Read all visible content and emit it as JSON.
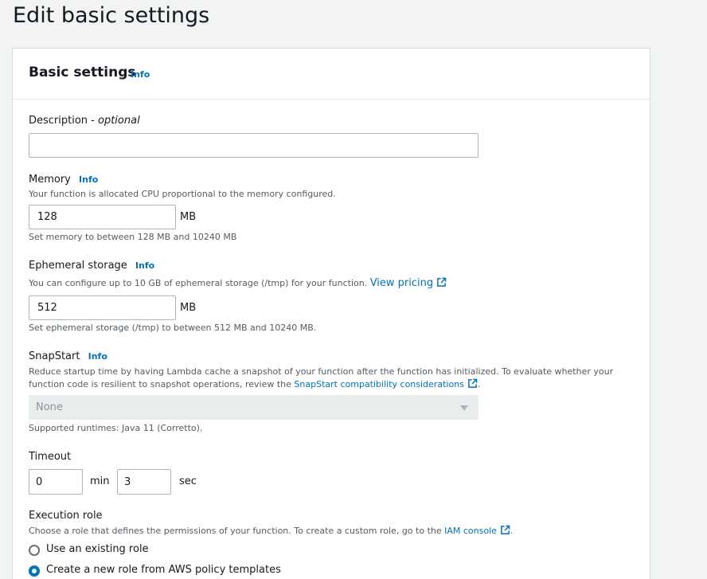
{
  "page_title": "Edit basic settings",
  "panel": {
    "title": "Basic settings",
    "info": "Info"
  },
  "description": {
    "label": "Description - ",
    "label_optional": "optional",
    "value": ""
  },
  "memory": {
    "label": "Memory",
    "info": "Info",
    "desc": "Your function is allocated CPU proportional to the memory configured.",
    "value": "128",
    "unit": "MB",
    "hint": "Set memory to between 128 MB and 10240 MB"
  },
  "ephemeral": {
    "label": "Ephemeral storage",
    "info": "Info",
    "desc": "You can configure up to 10 GB of ephemeral storage (/tmp) for your function.",
    "link": "View pricing",
    "value": "512",
    "unit": "MB",
    "hint": "Set ephemeral storage (/tmp) to between 512 MB and 10240 MB."
  },
  "snapstart": {
    "label": "SnapStart",
    "info": "Info",
    "desc_line1": "Reduce startup time by having Lambda cache a snapshot of your function after the function has initialized. To evaluate whether your",
    "desc_line2": "function code is resilient to snapshot operations, review the",
    "link": "SnapStart compatibility considerations",
    "selected": "None",
    "hint": "Supported runtimes: Java 11 (Corretto)."
  },
  "timeout": {
    "label": "Timeout",
    "min_value": "0",
    "min_unit": "min",
    "sec_value": "3",
    "sec_unit": "sec"
  },
  "execution_role": {
    "label": "Execution role",
    "desc": "Choose a role that defines the permissions of your function. To create a custom role, go to the",
    "link": "IAM console",
    "options": [
      {
        "label": "Use an existing role",
        "checked": false
      },
      {
        "label": "Create a new role from AWS policy templates",
        "checked": true
      }
    ]
  },
  "icons": {
    "external": "external-link-icon",
    "caret": "caret-down-icon",
    "radio": "radio-icon"
  },
  "colors": {
    "link": "#0073bb",
    "background": "#f2f3f3",
    "panel": "#ffffff",
    "text": "#16191f",
    "secondary_text": "#545b64"
  }
}
